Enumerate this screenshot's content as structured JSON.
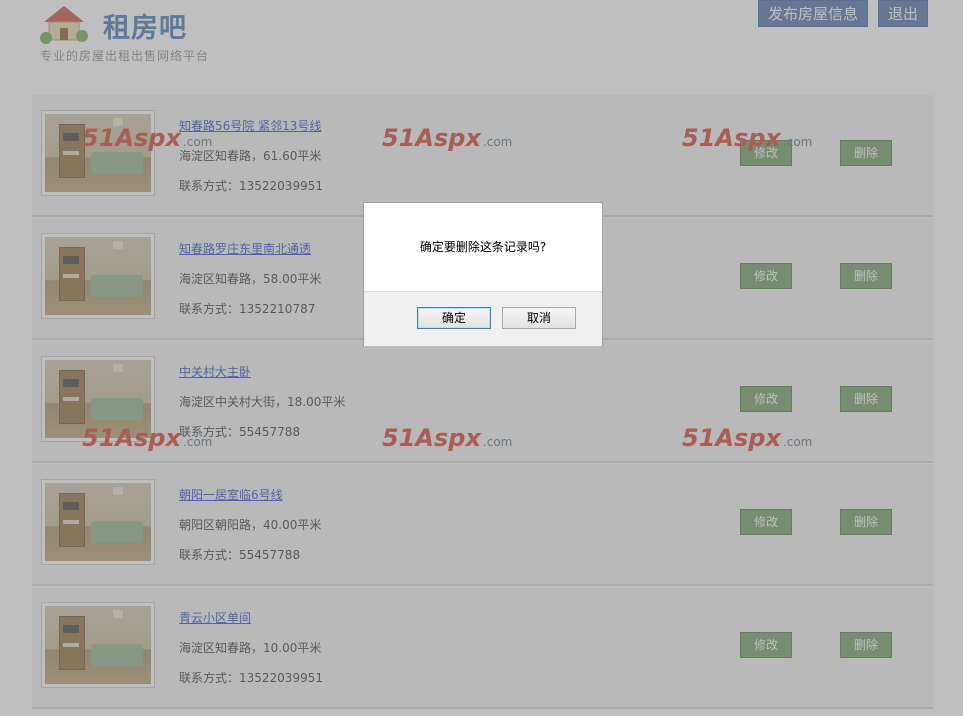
{
  "header": {
    "logo_title": "租房吧",
    "logo_subtitle": "专业的房屋出租出售网络平台",
    "publish_label": "发布房屋信息",
    "logout_label": "退出"
  },
  "listings": [
    {
      "title": "知春路56号院 紧邻13号线",
      "address": "海淀区知春路，61.60平米",
      "contact": "联系方式：13522039951",
      "edit": "修改",
      "delete": "删除"
    },
    {
      "title": "知春路罗庄东里南北通透",
      "address": "海淀区知春路，58.00平米",
      "contact": "联系方式：1352210787",
      "edit": "修改",
      "delete": "删除"
    },
    {
      "title": "中关村大主卧",
      "address": "海淀区中关村大街，18.00平米",
      "contact": "联系方式：55457788",
      "edit": "修改",
      "delete": "删除"
    },
    {
      "title": "朝阳一居室临6号线",
      "address": "朝阳区朝阳路，40.00平米",
      "contact": "联系方式：55457788",
      "edit": "修改",
      "delete": "删除"
    },
    {
      "title": "青云小区单间",
      "address": "海淀区知春路，10.00平米",
      "contact": "联系方式：13522039951",
      "edit": "修改",
      "delete": "删除"
    }
  ],
  "watermark": {
    "brand": "51Aspx",
    "suffix": ".com"
  },
  "dialog": {
    "message": "确定要删除这条记录吗?",
    "ok_label": "确定",
    "cancel_label": "取消"
  },
  "colors": {
    "brand_blue": "#3a72b8",
    "header_button": "#4a6fa8",
    "action_green": "#6f9a60",
    "link_blue": "#2844c8"
  }
}
